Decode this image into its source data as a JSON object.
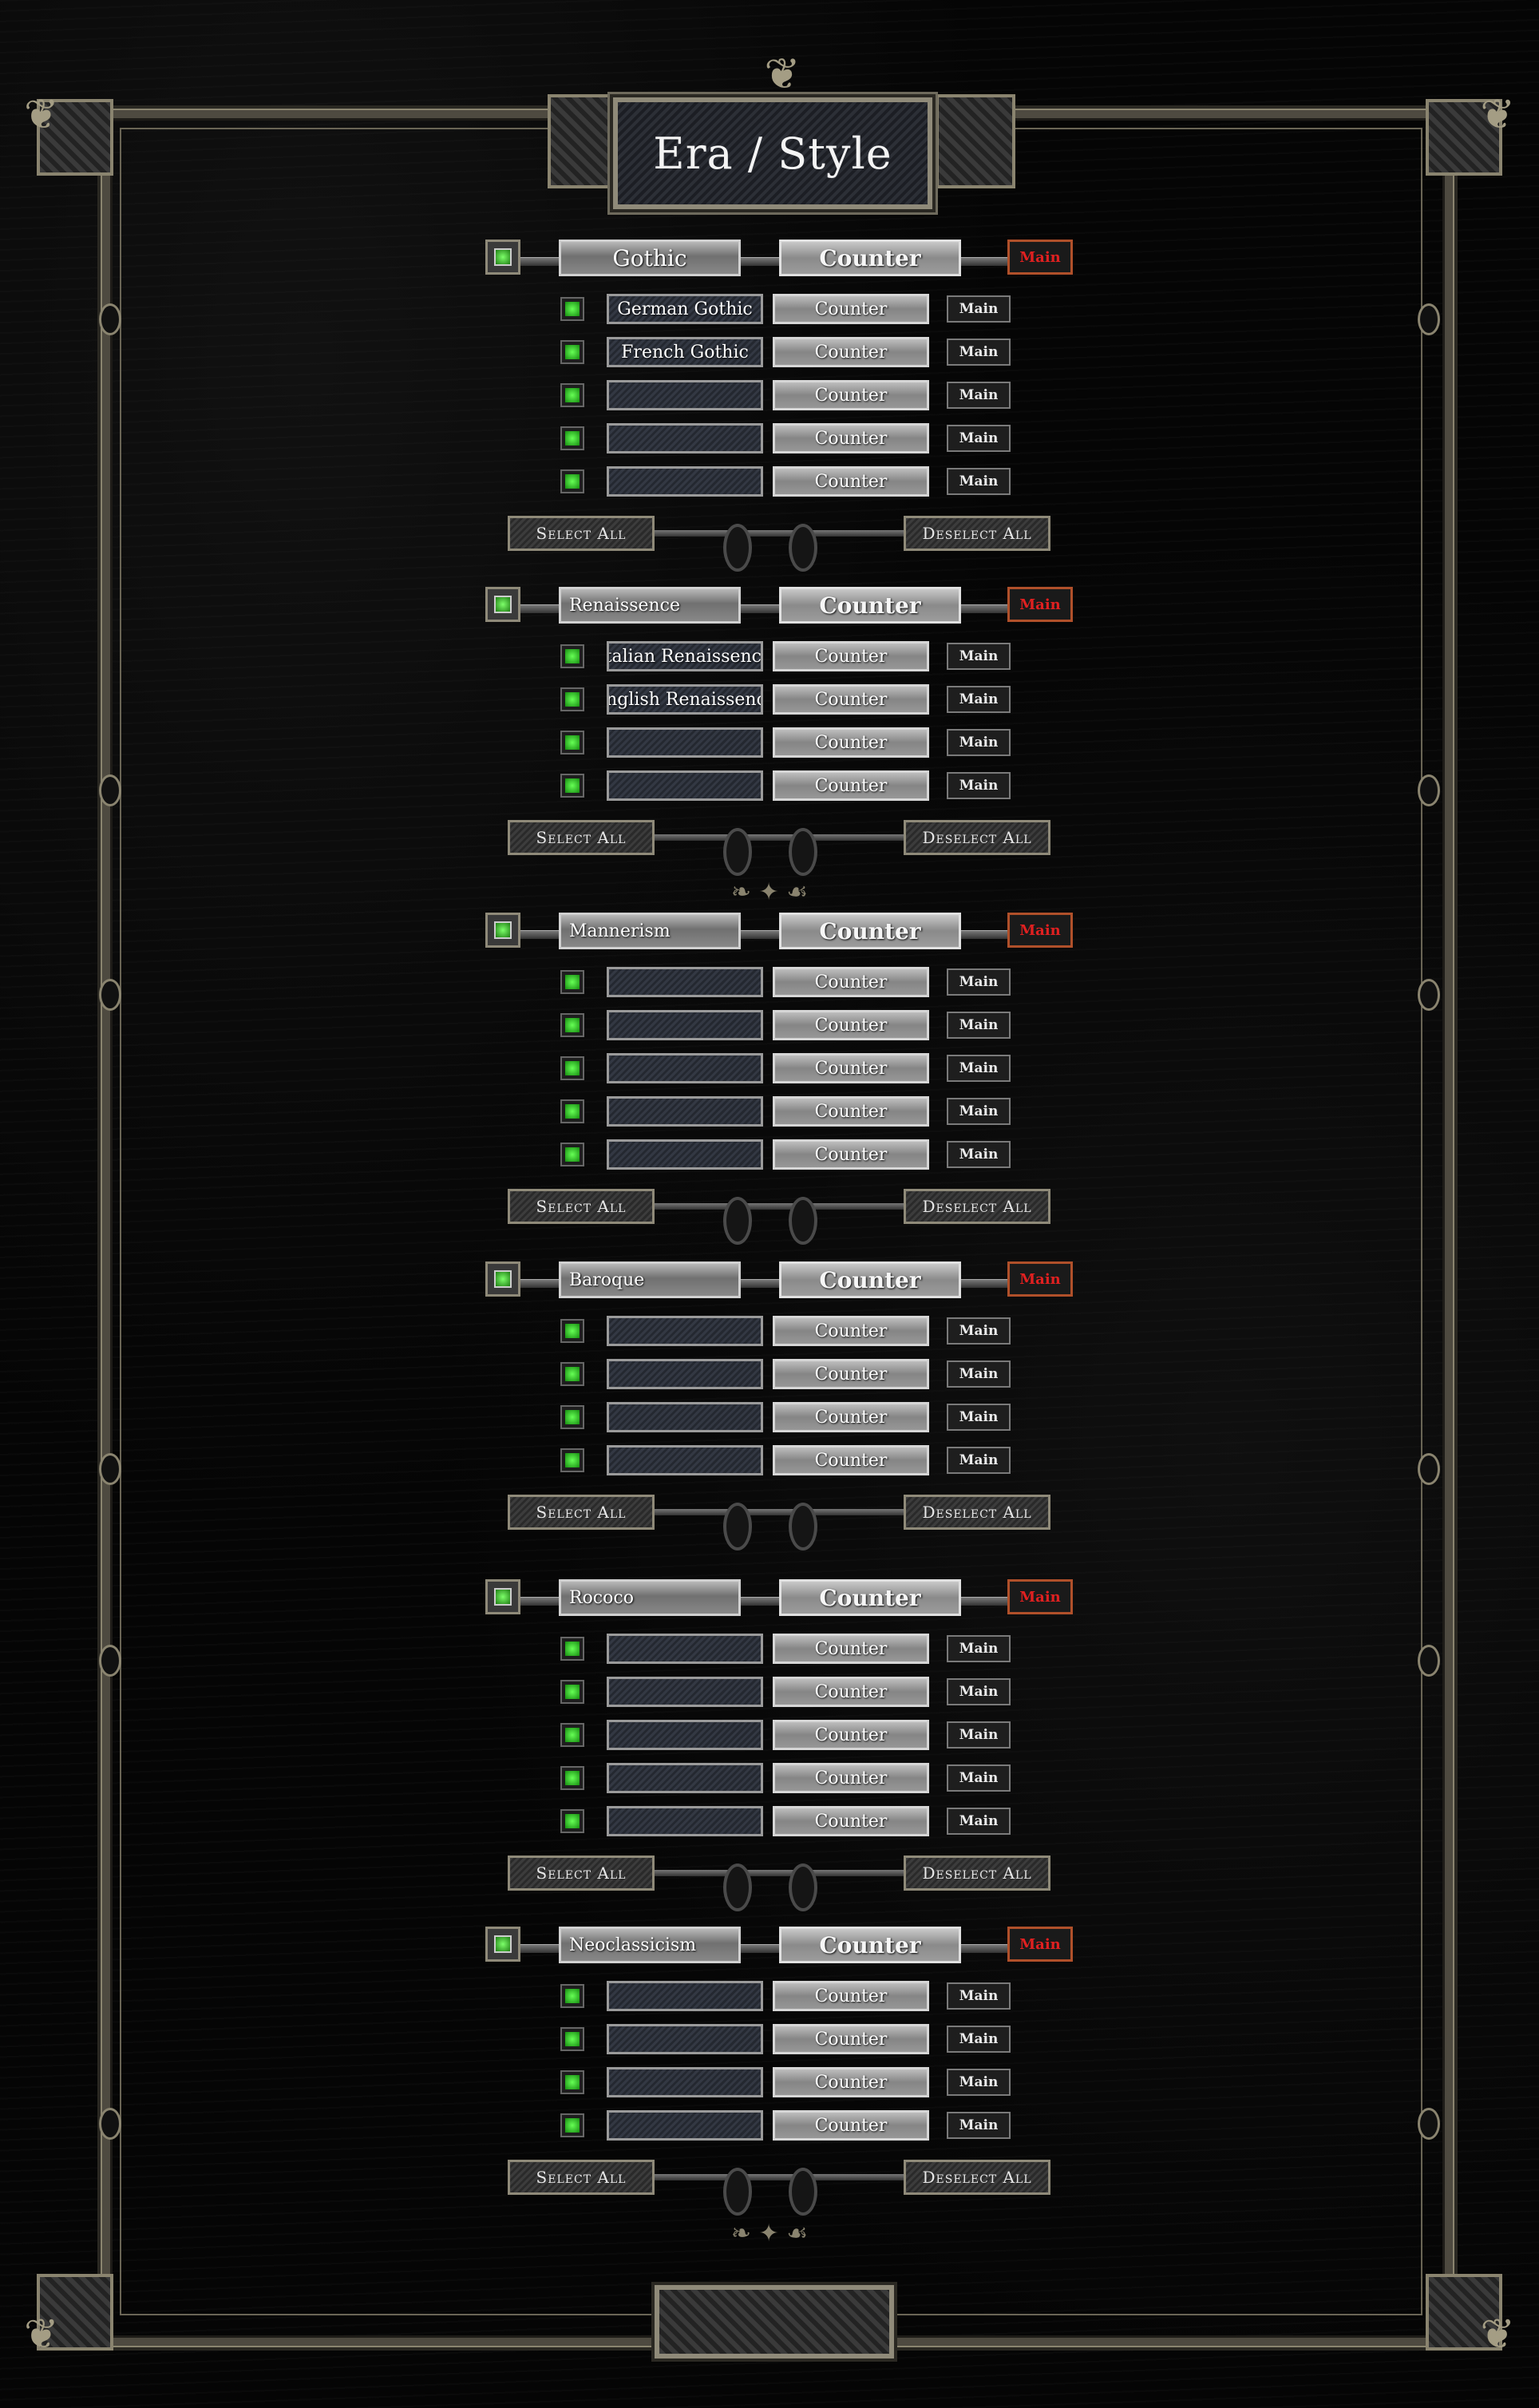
{
  "window": {
    "title": "Era / Style"
  },
  "groups": [
    {
      "name": "Gothic",
      "counter": "Counter",
      "main": "Main",
      "rows": [
        {
          "name": "German Gothic",
          "counter": "Counter",
          "main": "Main"
        },
        {
          "name": "French Gothic",
          "counter": "Counter",
          "main": "Main"
        },
        {
          "name": "",
          "counter": "Counter",
          "main": "Main"
        },
        {
          "name": "",
          "counter": "Counter",
          "main": "Main"
        },
        {
          "name": "",
          "counter": "Counter",
          "main": "Main"
        }
      ],
      "select_all": "Select All",
      "deselect_all": "Deselect All"
    },
    {
      "name": "Renaissence",
      "counter": "Counter",
      "main": "Main",
      "rows": [
        {
          "name": "Italian Renaissence",
          "counter": "Counter",
          "main": "Main"
        },
        {
          "name": "English Renaissence",
          "counter": "Counter",
          "main": "Main"
        },
        {
          "name": "",
          "counter": "Counter",
          "main": "Main"
        },
        {
          "name": "",
          "counter": "Counter",
          "main": "Main"
        }
      ],
      "select_all": "Select All",
      "deselect_all": "Deselect All"
    },
    {
      "name": "Mannerism",
      "counter": "Counter",
      "main": "Main",
      "rows": [
        {
          "name": "",
          "counter": "Counter",
          "main": "Main"
        },
        {
          "name": "",
          "counter": "Counter",
          "main": "Main"
        },
        {
          "name": "",
          "counter": "Counter",
          "main": "Main"
        },
        {
          "name": "",
          "counter": "Counter",
          "main": "Main"
        },
        {
          "name": "",
          "counter": "Counter",
          "main": "Main"
        }
      ],
      "select_all": "Select All",
      "deselect_all": "Deselect All"
    },
    {
      "name": "Baroque",
      "counter": "Counter",
      "main": "Main",
      "rows": [
        {
          "name": "",
          "counter": "Counter",
          "main": "Main"
        },
        {
          "name": "",
          "counter": "Counter",
          "main": "Main"
        },
        {
          "name": "",
          "counter": "Counter",
          "main": "Main"
        },
        {
          "name": "",
          "counter": "Counter",
          "main": "Main"
        }
      ],
      "select_all": "Select All",
      "deselect_all": "Deselect All"
    },
    {
      "name": "Rococo",
      "counter": "Counter",
      "main": "Main",
      "rows": [
        {
          "name": "",
          "counter": "Counter",
          "main": "Main"
        },
        {
          "name": "",
          "counter": "Counter",
          "main": "Main"
        },
        {
          "name": "",
          "counter": "Counter",
          "main": "Main"
        },
        {
          "name": "",
          "counter": "Counter",
          "main": "Main"
        },
        {
          "name": "",
          "counter": "Counter",
          "main": "Main"
        }
      ],
      "select_all": "Select All",
      "deselect_all": "Deselect All"
    },
    {
      "name": "Neoclassicism",
      "counter": "Counter",
      "main": "Main",
      "rows": [
        {
          "name": "",
          "counter": "Counter",
          "main": "Main"
        },
        {
          "name": "",
          "counter": "Counter",
          "main": "Main"
        },
        {
          "name": "",
          "counter": "Counter",
          "main": "Main"
        },
        {
          "name": "",
          "counter": "Counter",
          "main": "Main"
        }
      ],
      "select_all": "Select All",
      "deselect_all": "Deselect All"
    }
  ],
  "icons": {
    "group_checkbox": "green-gem-checkbox-icon",
    "row_checkbox": "green-gem-checkbox-icon"
  },
  "colors": {
    "frame": "#8f8a79",
    "main_accent": "#e02020",
    "check_green": "#66ff55"
  }
}
